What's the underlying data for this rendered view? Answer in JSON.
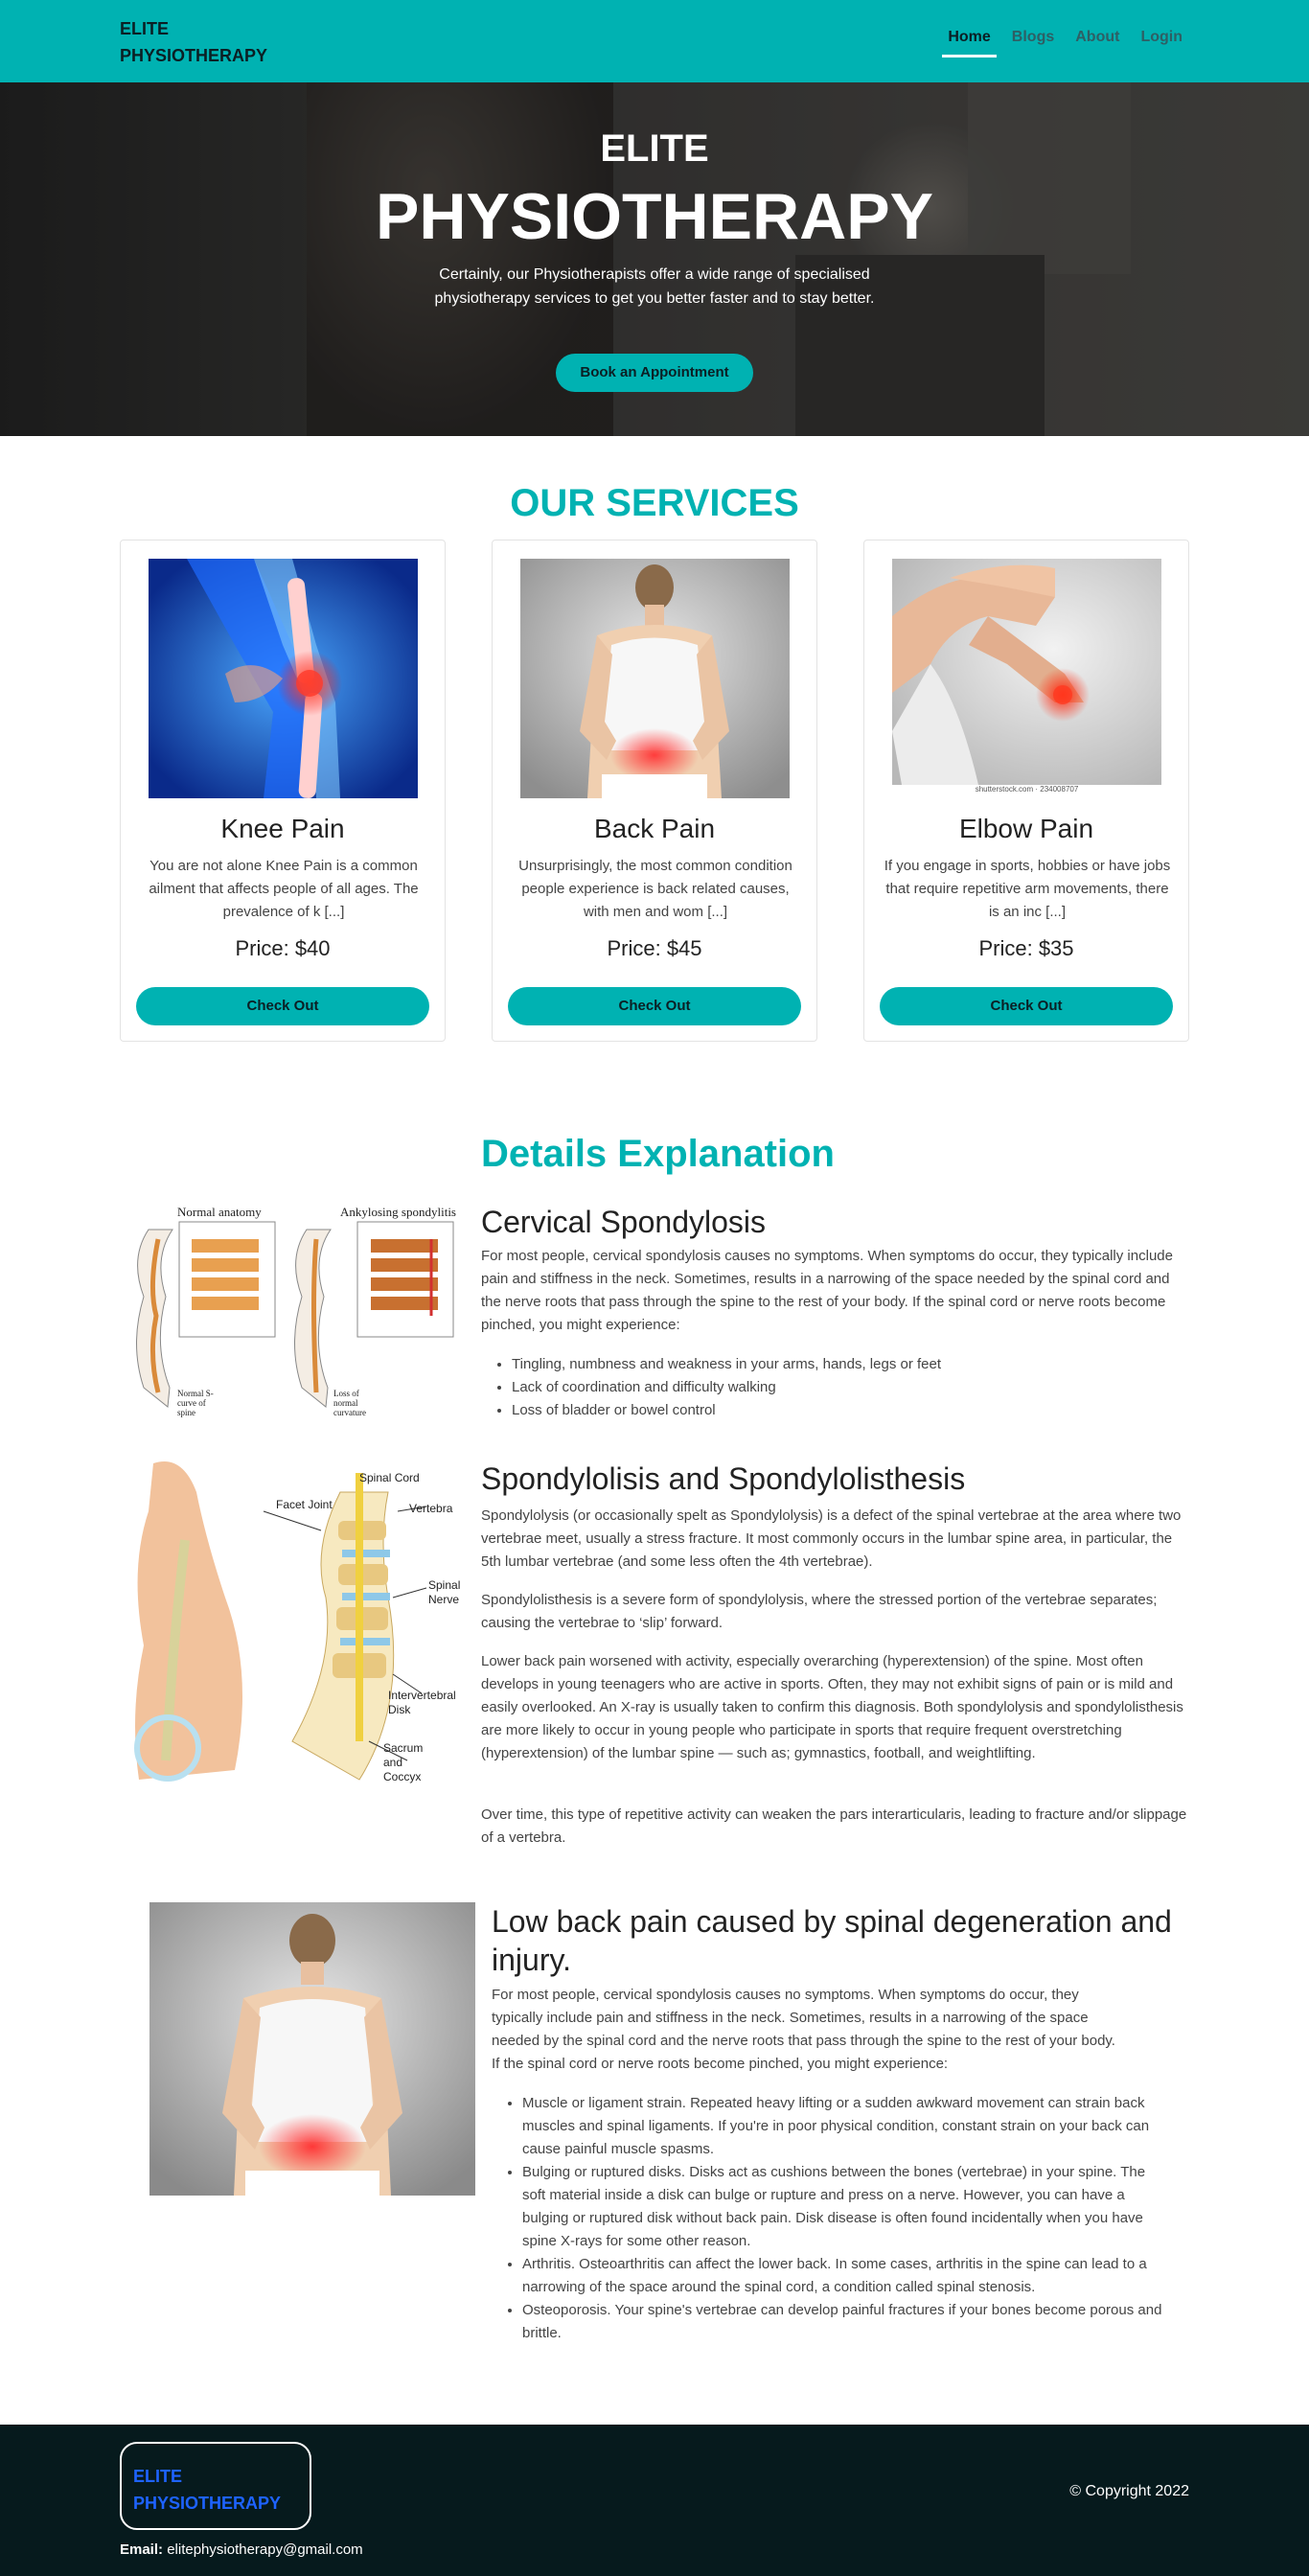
{
  "nav": {
    "brand_line1": "ELITE",
    "brand_line2": "PHYSIOTHERAPY",
    "links": [
      "Home",
      "Blogs",
      "About",
      "Login"
    ],
    "active": "Home"
  },
  "hero": {
    "title_line1": "ELITE",
    "title_line2": "PHYSIOTHERAPY",
    "text": "Certainly, our Physiotherapists offer a wide range of specialised physiotherapy services to get you better faster and to stay better.",
    "button": "Book an Appointment"
  },
  "services": {
    "title": "OUR SERVICES",
    "cards": [
      {
        "name": "Knee Pain",
        "description": "You are not alone Knee Pain is a common ailment that affects people of all ages. The prevalence of k [...]",
        "price": "Price: $40",
        "button": "Check Out",
        "image": "knee-xray-image"
      },
      {
        "name": "Back Pain",
        "description": "Unsurprisingly, the most common condition people experience is back related causes, with men and wom [...]",
        "price": "Price: $45",
        "button": "Check Out",
        "image": "back-pain-image"
      },
      {
        "name": "Elbow Pain",
        "description": "If you engage in sports, hobbies or have jobs that require repetitive arm movements, there is an inc [...]",
        "price": "Price: $35",
        "button": "Check Out",
        "image": "elbow-pain-image",
        "image_caption": "shutterstock.com · 234008707"
      }
    ]
  },
  "details": {
    "title": "Details Explanation",
    "cervical": {
      "heading": "Cervical Spondylosis",
      "image_labels": {
        "left": "Normal anatomy",
        "right": "Ankylosing spondylitis",
        "bottom_left": "Normal S-curve of spine",
        "bottom_right": "Loss of normal curvature"
      },
      "text": "For most people, cervical spondylosis causes no symptoms. When symptoms do occur, they typically include pain and stiffness in the neck. Sometimes, results in a narrowing of the space needed by the spinal cord and the nerve roots that pass through the spine to the rest of your body. If the spinal cord or nerve roots become pinched, you might experience:",
      "items": [
        "Tingling, numbness and weakness in your arms, hands, legs or feet",
        "Lack of coordination and difficulty walking",
        "Loss of bladder or bowel control"
      ]
    },
    "spondylolisis": {
      "heading": "Spondylolisis and Spondylolisthesis",
      "image_labels": [
        "Spinal Cord",
        "Facet Joint",
        "Vertebra",
        "Spinal Nerve",
        "Intervertebral Disk",
        "Sacrum and Coccyx"
      ],
      "p1": "Spondylolysis (or occasionally spelt as Spondylolysis) is a defect of the spinal vertebrae at the area where two vertebrae meet, usually a stress fracture. It most commonly occurs in the lumbar spine area, in particular, the 5th lumbar vertebrae (and some less often the 4th vertebrae).",
      "p2": "Spondylolisthesis is a severe form of spondylolysis, where the stressed portion of the vertebrae separates; causing the vertebrae to ‘slip’ forward.",
      "p3": "Lower back pain worsened with activity, especially overarching (hyperextension) of the spine. Most often develops in young teenagers who are active in sports. Often, they may not exhibit signs of pain or is mild and easily overlooked. An X-ray is usually taken to confirm this diagnosis. Both spondylolysis and spondylolisthesis are more likely to occur in young people who participate in sports that require frequent overstretching (hyperextension) of the lumbar spine — such as; gymnastics, football, and weightlifting.",
      "p4": "Over time, this type of repetitive activity can weaken the pars interarticularis, leading to fracture and/or slippage of a vertebra."
    },
    "lowback": {
      "heading": "Low back pain caused by spinal degeneration and injury.",
      "text": "For most people, cervical spondylosis causes no symptoms. When symptoms do occur, they typically include pain and stiffness in the neck. Sometimes, results in a narrowing of the space needed by the spinal cord and the nerve roots that pass through the spine to the rest of your body. If the spinal cord or nerve roots become pinched, you might experience:",
      "items": [
        "Muscle or ligament strain. Repeated heavy lifting or a sudden awkward movement can strain back muscles and spinal ligaments. If you're in poor physical condition, constant strain on your back can cause painful muscle spasms.",
        "Bulging or ruptured disks. Disks act as cushions between the bones (vertebrae) in your spine. The soft material inside a disk can bulge or rupture and press on a nerve. However, you can have a bulging or ruptured disk without back pain. Disk disease is often found incidentally when you have spine X-rays for some other reason.",
        "Arthritis. Osteoarthritis can affect the lower back. In some cases, arthritis in the spine can lead to a narrowing of the space around the spinal cord, a condition called spinal stenosis.",
        "Osteoporosis. Your spine's vertebrae can develop painful fractures if your bones become porous and brittle."
      ]
    }
  },
  "footer": {
    "brand_line1": "ELITE",
    "brand_line2": "PHYSIOTHERAPY",
    "copyright": "© Copyright 2022",
    "email_label": "Email:",
    "email": "elitephysiotherapy@gmail.com"
  },
  "colors": {
    "accent": "#00b2b2",
    "footer": "#061a1d",
    "footer_brand": "#1e63ff"
  }
}
